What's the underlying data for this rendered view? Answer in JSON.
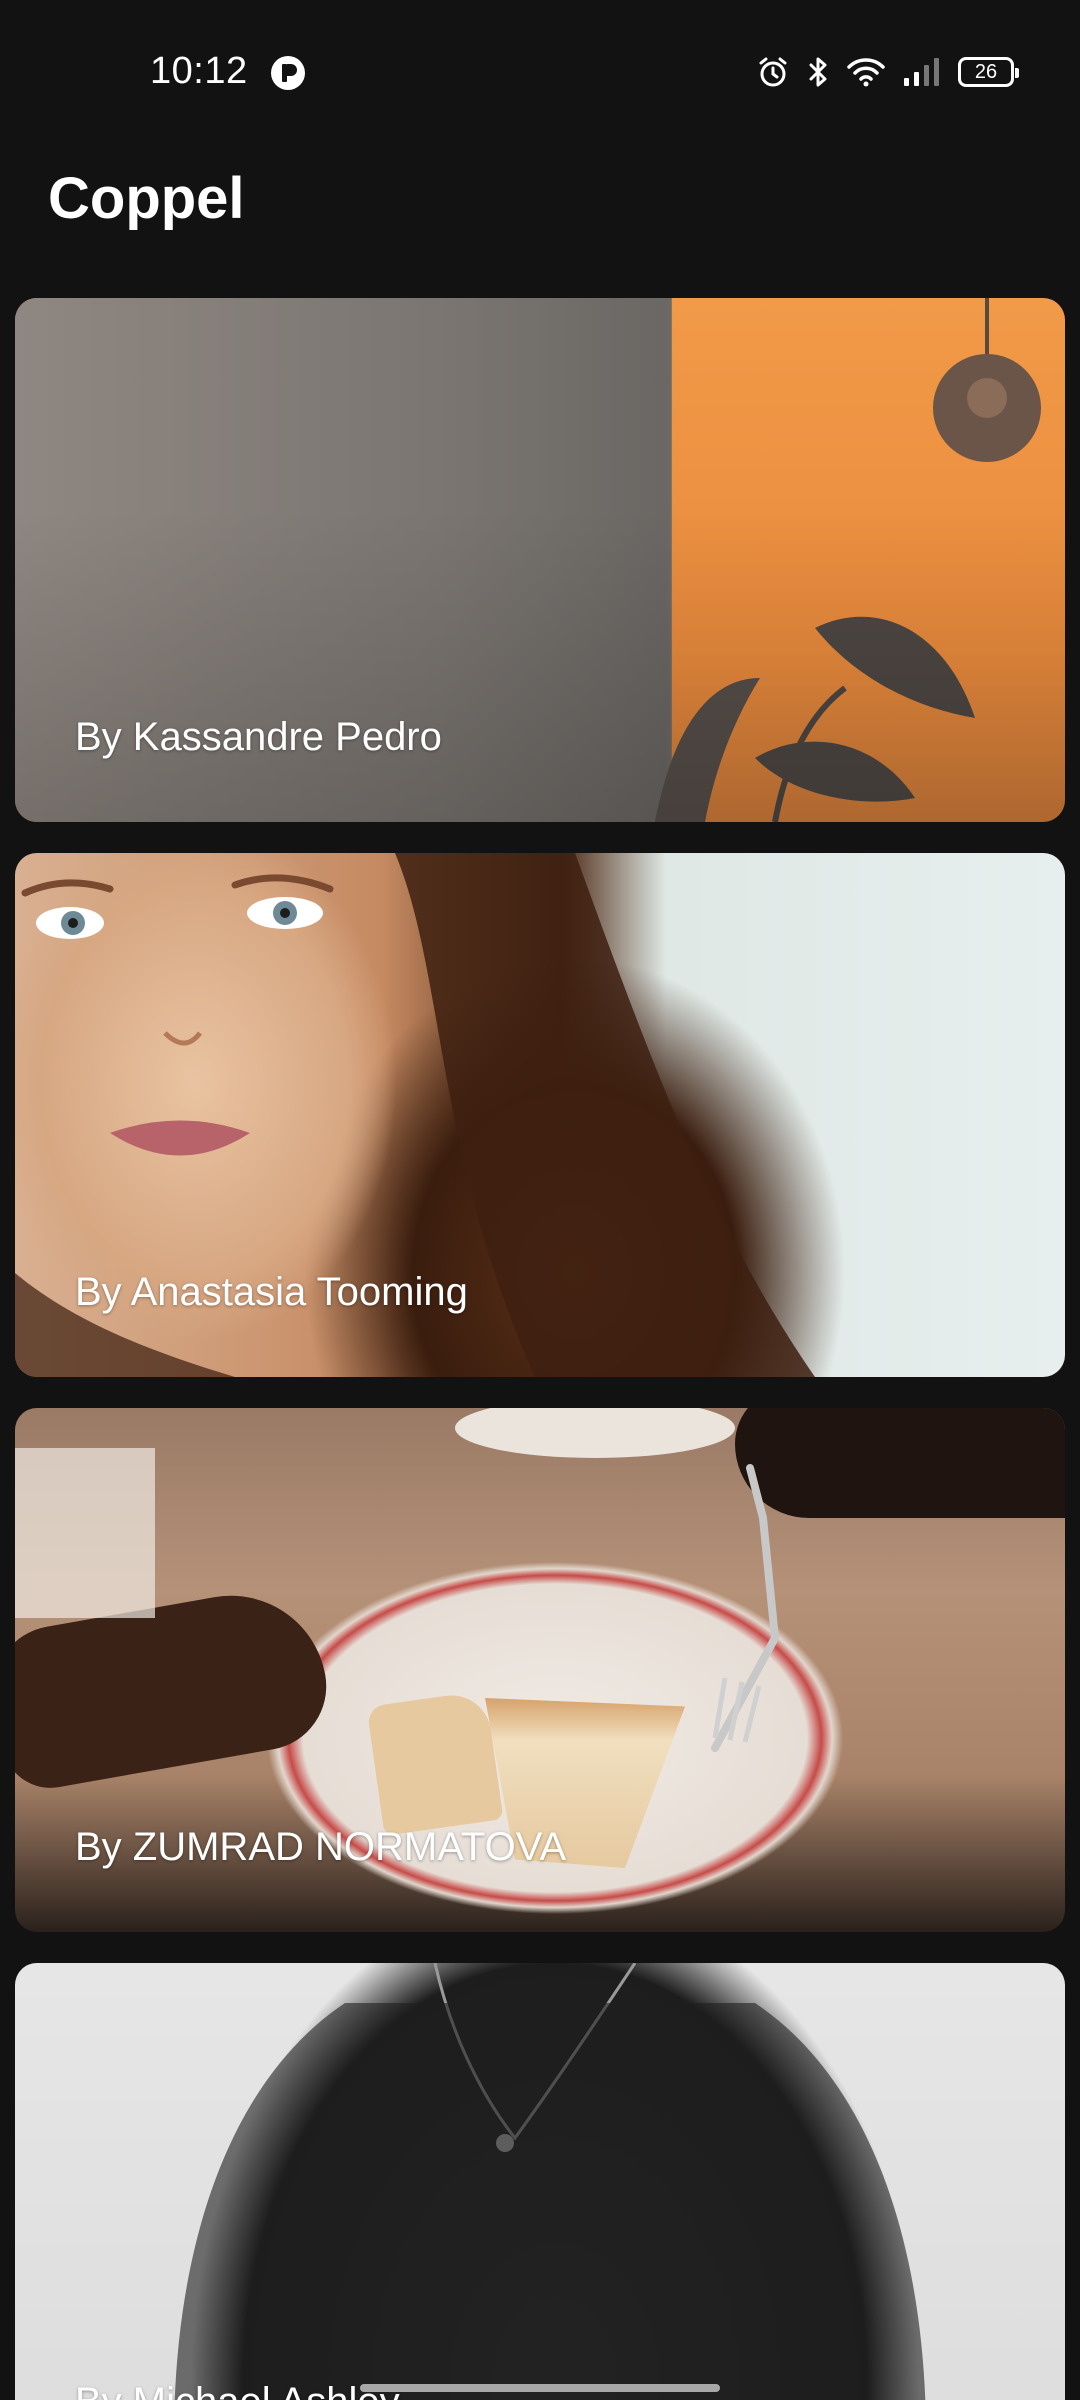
{
  "status_bar": {
    "time": "10:12",
    "battery": "26",
    "icons": [
      "app-notification-icon",
      "alarm-icon",
      "bluetooth-icon",
      "wifi-icon",
      "cellular-signal-icon",
      "battery-icon"
    ]
  },
  "app": {
    "title": "Coppel"
  },
  "feed": {
    "items": [
      {
        "author": "By Kassandre Pedro"
      },
      {
        "author": "By Anastasia Tooming"
      },
      {
        "author": "By ZUMRAD NORMATOVA"
      },
      {
        "author": "By Michael Ashley"
      }
    ]
  },
  "colors": {
    "background": "#121212",
    "text": "#ffffff"
  }
}
